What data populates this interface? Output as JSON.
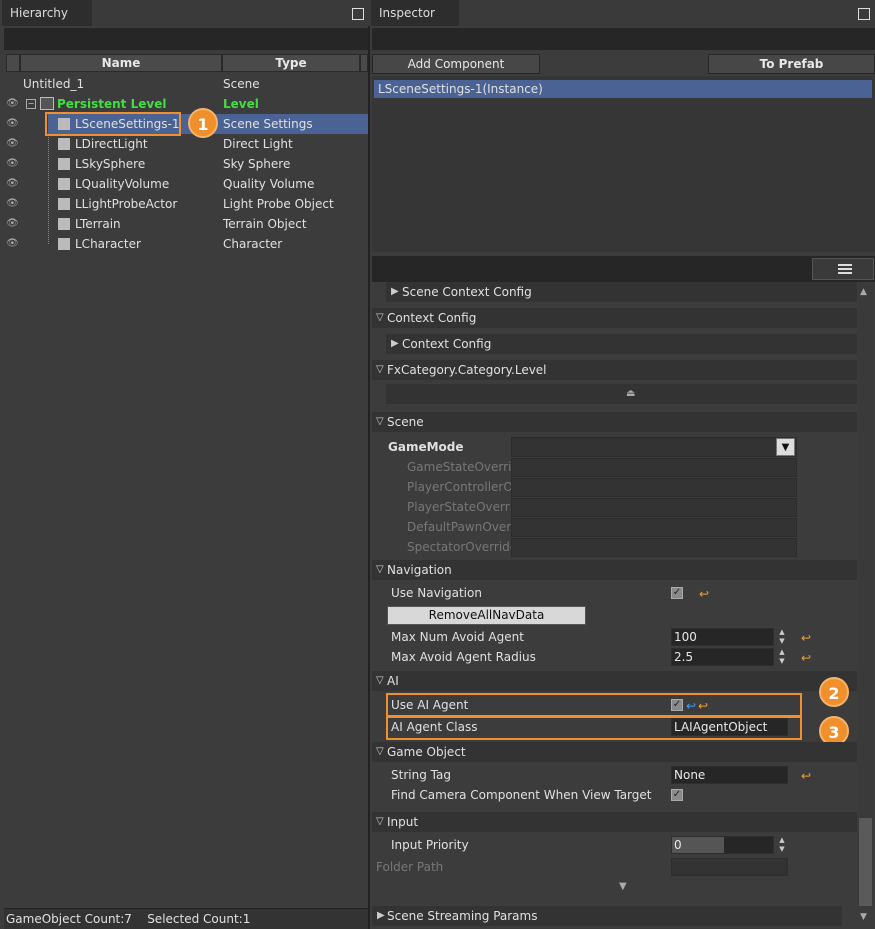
{
  "hierarchy": {
    "title": "Hierarchy",
    "col_name": "Name",
    "col_type": "Type",
    "root": "Untitled_1",
    "root_type": "Scene",
    "level": "Persistent Level",
    "level_type": "Level",
    "items": [
      {
        "name": "LSceneSettings-1",
        "type": "Scene Settings"
      },
      {
        "name": "LDirectLight",
        "type": "Direct Light"
      },
      {
        "name": "LSkySphere",
        "type": "Sky Sphere"
      },
      {
        "name": "LQualityVolume",
        "type": "Quality Volume"
      },
      {
        "name": "LLightProbeActor",
        "type": "Light Probe Object"
      },
      {
        "name": "LTerrain",
        "type": "Terrain Object"
      },
      {
        "name": "LCharacter",
        "type": "Character"
      }
    ],
    "status": "GameObject Count:7    Selected Count:1"
  },
  "inspector": {
    "title": "Inspector",
    "add_component": "Add Component",
    "to_prefab": "To Prefab",
    "instance": "LSceneSettings-1(Instance)",
    "sections": {
      "scene_context_config": "Scene Context Config",
      "context_config": "Context Config",
      "context_config_sub": "Context Config",
      "fx_category": "FxCategory.Category.Level",
      "scene": "Scene",
      "navigation": "Navigation",
      "ai": "AI",
      "game_object": "Game Object",
      "input": "Input",
      "scene_streaming": "Scene Streaming Params"
    },
    "scene_props": {
      "game_mode": "GameMode",
      "game_state": "GameStateOverric",
      "player_controller": "PlayerControllerO",
      "player_state": "PlayerStateOverri",
      "default_pawn": "DefaultPawnOverr",
      "spectator": "SpectatorOverride"
    },
    "navigation": {
      "use_navigation": "Use Navigation",
      "remove_btn": "RemoveAllNavData",
      "max_num_avoid": "Max Num Avoid Agent",
      "max_num_avoid_value": "100",
      "max_avoid_radius": "Max Avoid Agent Radius",
      "max_avoid_radius_value": "2.5"
    },
    "ai": {
      "use_ai_agent": "Use AI Agent",
      "ai_agent_class": "AI Agent Class",
      "ai_agent_class_value": "LAIAgentObject"
    },
    "game_object": {
      "string_tag": "String Tag",
      "string_tag_value": "None",
      "find_camera": "Find Camera Component When View Target"
    },
    "input": {
      "input_priority": "Input Priority",
      "input_priority_value": "0",
      "folder_path": "Folder Path"
    }
  },
  "badges": [
    "1",
    "2",
    "3"
  ],
  "colors": {
    "accent": "#f0902c",
    "selection": "#4a6394",
    "level_green": "#3ee03e"
  }
}
